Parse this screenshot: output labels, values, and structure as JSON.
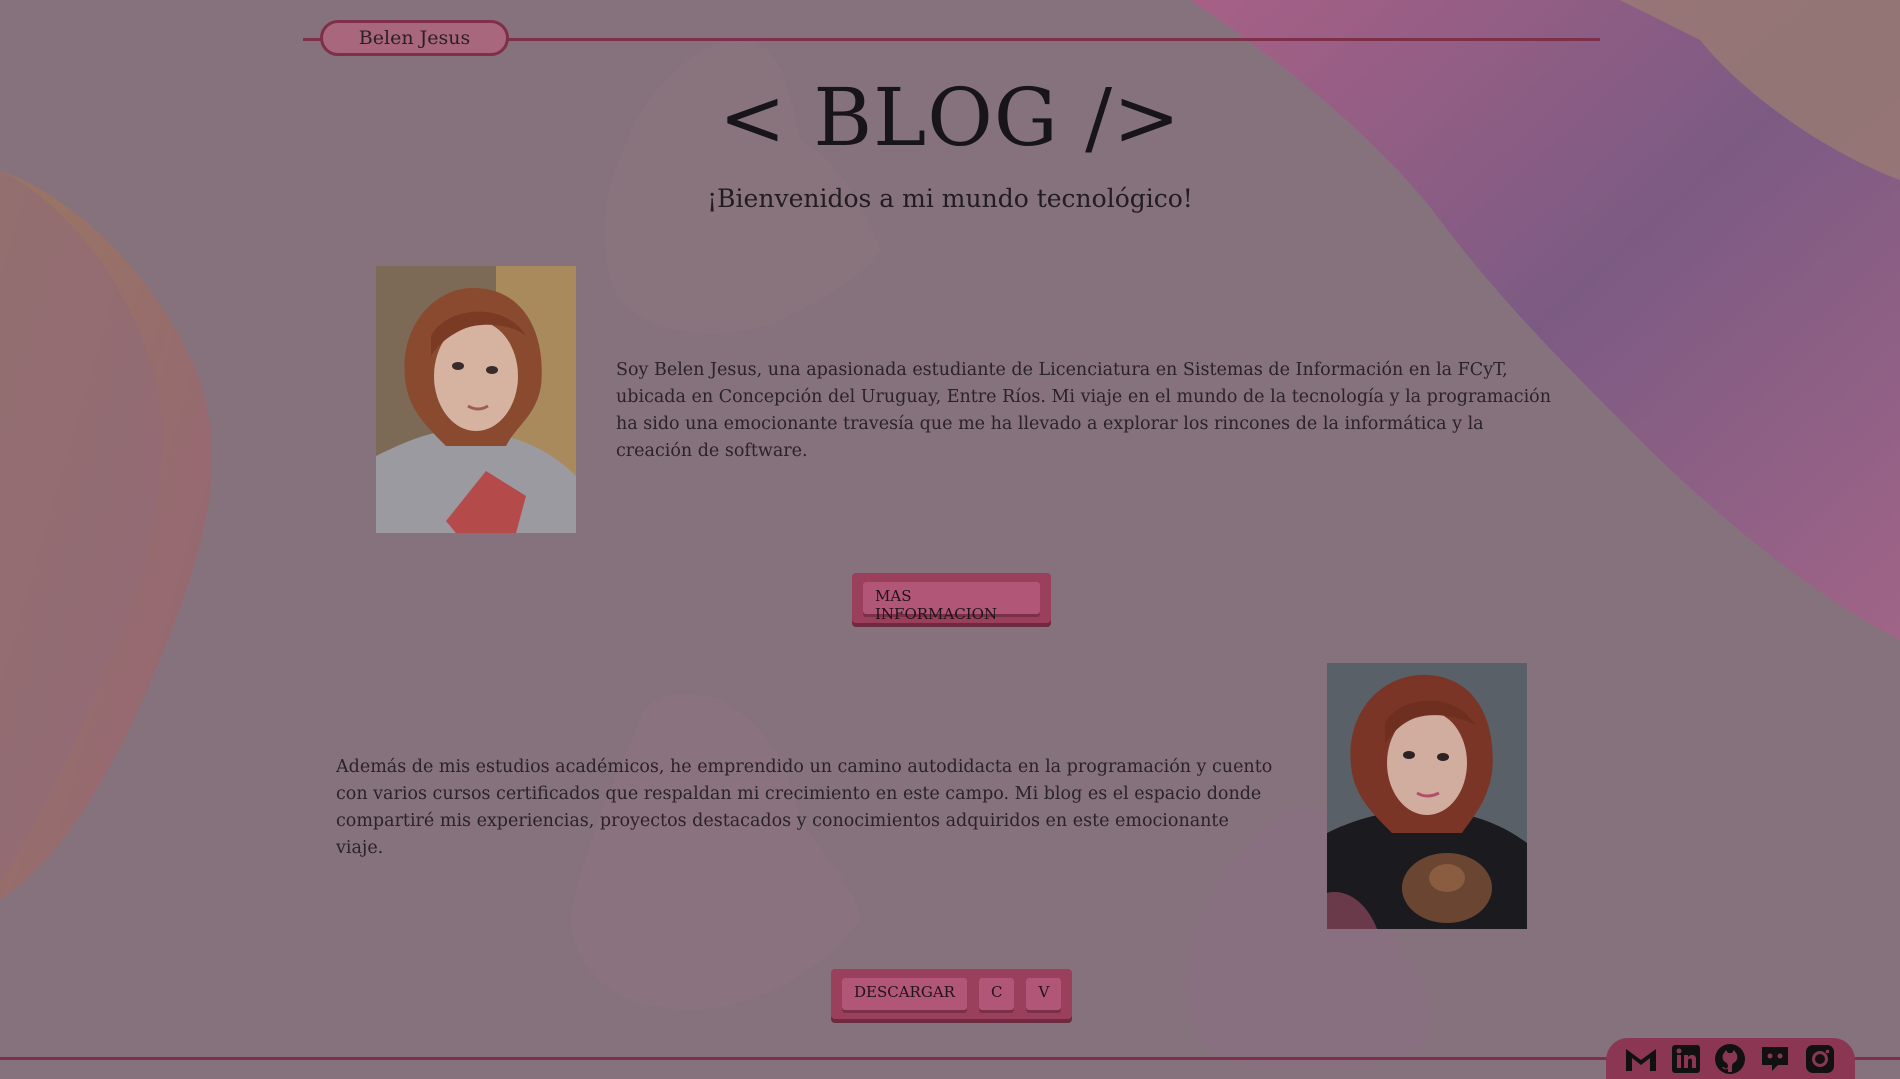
{
  "header": {
    "name_tag": "Belen Jesus"
  },
  "hero": {
    "title": "< BLOG />",
    "subtitle": "¡Bienvenidos a mi mundo tecnológico!"
  },
  "about": {
    "photo_alt": "Foto de Belen Jesus",
    "paragraph": "Soy Belen Jesus, una apasionada estudiante de Licenciatura en Sistemas de Información en la FCyT, ubicada en Concepción del Uruguay, Entre Ríos. Mi viaje en el mundo de la tecnología y la programación ha sido una emocionante travesía que me ha llevado a explorar los rincones de la informática y la creación de software.",
    "more_button": "MAS INFORMACION"
  },
  "studies": {
    "paragraph": "Además de mis estudios académicos, he emprendido un camino autodidacta en la programación y cuento con varios cursos certificados que respaldan mi crecimiento en este campo. Mi blog es el espacio donde compartiré mis experiencias, proyectos destacados y conocimientos adquiridos en este emocionante viaje.",
    "photo_alt": "Foto de Belen Jesus con peluche"
  },
  "download": {
    "download_label": "DESCARGAR",
    "c_label": "C",
    "v_label": "V"
  },
  "social": [
    {
      "name": "gmail-icon"
    },
    {
      "name": "linkedin-icon"
    },
    {
      "name": "github-icon"
    },
    {
      "name": "discord-icon"
    },
    {
      "name": "instagram-icon"
    }
  ],
  "colors": {
    "background": "#86727c",
    "accent": "#7e2f49",
    "button": "#9a3f5c",
    "button_inner": "#b25677",
    "text": "#1e1a1d"
  }
}
